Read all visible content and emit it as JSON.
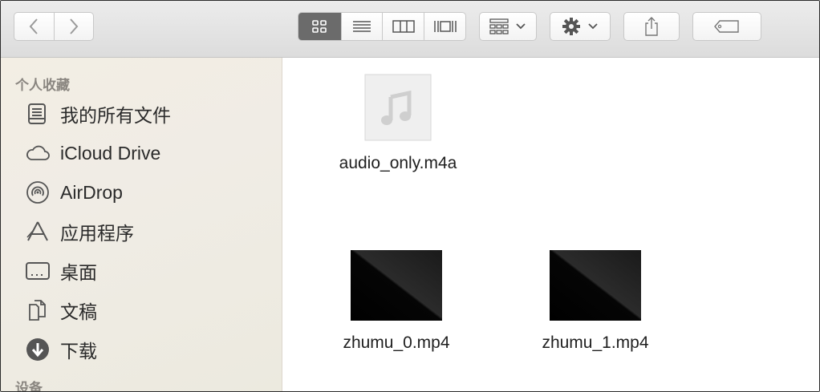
{
  "toolbar": {
    "back": "back-icon",
    "forward": "forward-icon",
    "view_modes": [
      "icon-view-icon",
      "list-view-icon",
      "column-view-icon",
      "coverflow-view-icon"
    ],
    "arrange": "arrange-icon",
    "action": "gear-icon",
    "share": "share-icon",
    "tags": "tag-icon"
  },
  "sidebar": {
    "favorites_title": "个人收藏",
    "items": [
      {
        "label": "我的所有文件",
        "icon": "all-files-icon"
      },
      {
        "label": "iCloud Drive",
        "icon": "cloud-icon"
      },
      {
        "label": "AirDrop",
        "icon": "airdrop-icon"
      },
      {
        "label": "应用程序",
        "icon": "applications-icon"
      },
      {
        "label": "桌面",
        "icon": "desktop-icon"
      },
      {
        "label": "文稿",
        "icon": "documents-icon"
      },
      {
        "label": "下载",
        "icon": "downloads-icon"
      }
    ],
    "devices_title": "设备"
  },
  "files": [
    {
      "name": "audio_only.m4a",
      "kind": "audio"
    },
    {
      "name": "zhumu_0.mp4",
      "kind": "video"
    },
    {
      "name": "zhumu_1.mp4",
      "kind": "video"
    }
  ]
}
